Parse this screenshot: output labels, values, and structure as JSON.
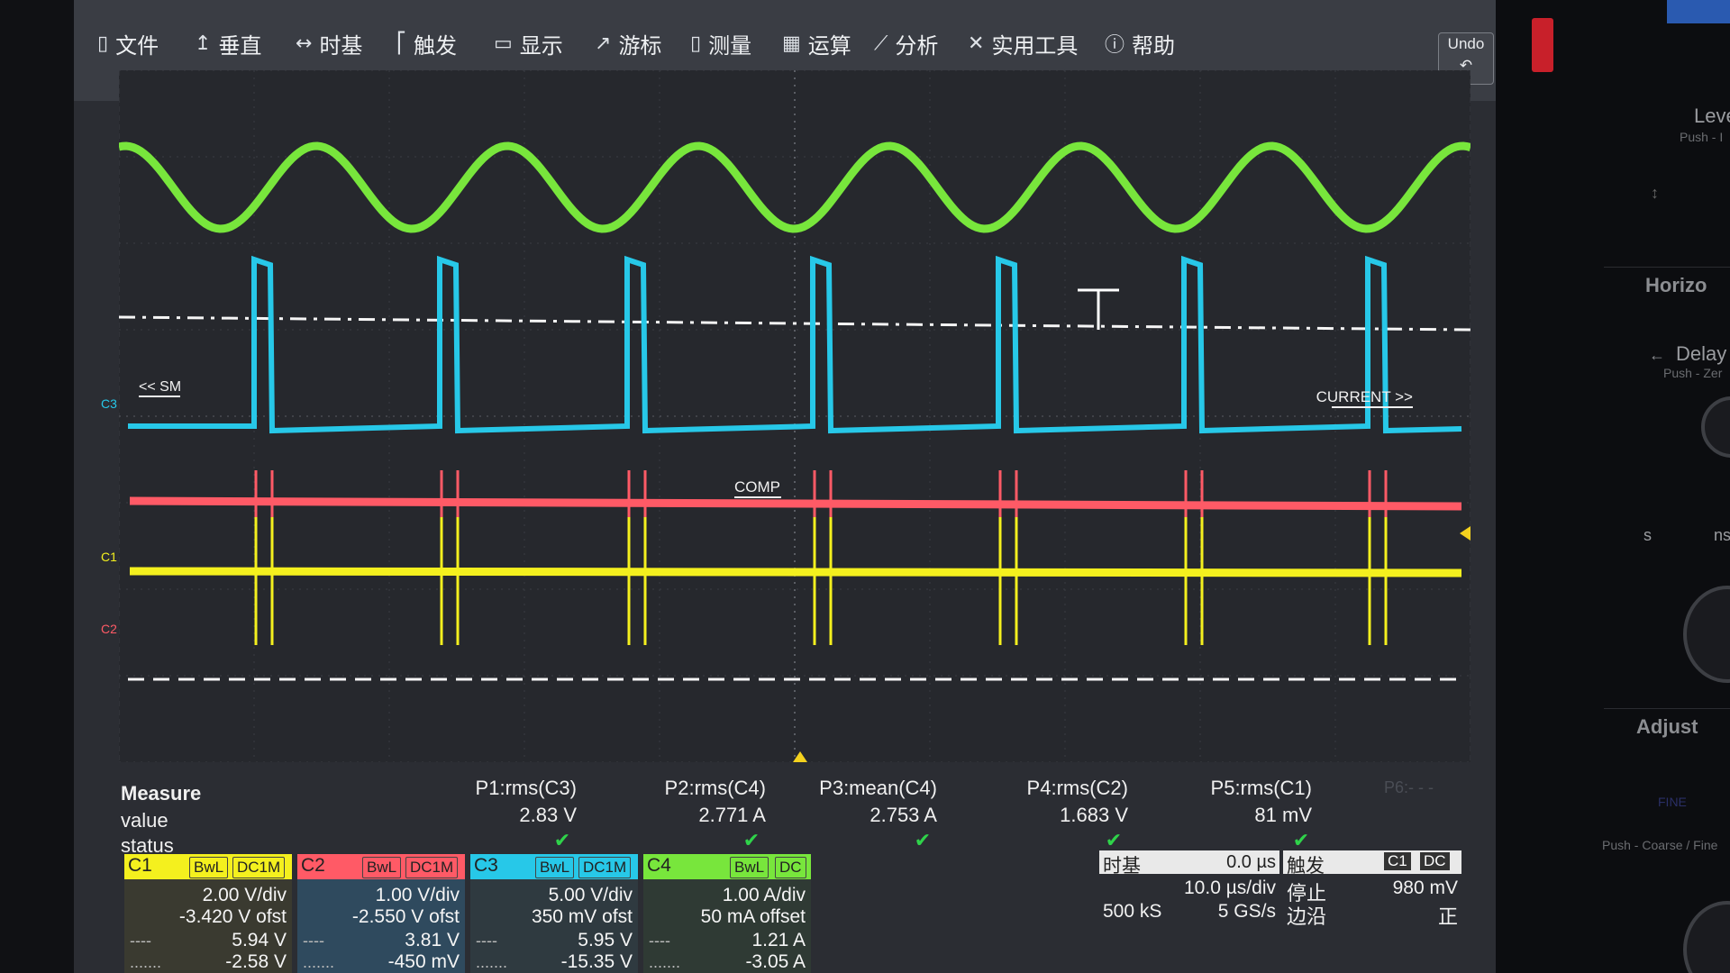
{
  "menu": {
    "items": [
      {
        "icon": "file-icon",
        "glyph": "▯",
        "label": "文件"
      },
      {
        "icon": "vertical-icon",
        "glyph": "↥",
        "label": "垂直"
      },
      {
        "icon": "timebase-icon",
        "glyph": "↔",
        "label": "时基"
      },
      {
        "icon": "trigger-icon",
        "glyph": "⎡",
        "label": "触发"
      },
      {
        "icon": "display-icon",
        "glyph": "▭",
        "label": "显示"
      },
      {
        "icon": "cursor-icon",
        "glyph": "↗",
        "label": "游标"
      },
      {
        "icon": "measure-icon",
        "glyph": "▯",
        "label": "测量"
      },
      {
        "icon": "math-icon",
        "glyph": "▦",
        "label": "运算"
      },
      {
        "icon": "analysis-icon",
        "glyph": "⟋",
        "label": "分析"
      },
      {
        "icon": "utilities-icon",
        "glyph": "✕",
        "label": "实用工具"
      },
      {
        "icon": "help-icon",
        "glyph": "ⓘ",
        "label": "帮助"
      }
    ],
    "undo": "Undo"
  },
  "waveform": {
    "labels": {
      "sm": "<< SM",
      "current": "CURRENT >>",
      "comp": "COMP"
    },
    "channel_markers": {
      "c3": "C3",
      "c1": "C1",
      "c2": "C2"
    },
    "colors": {
      "c1": "#f4f01e",
      "c2": "#ff5a66",
      "c3": "#27c8e8",
      "c4": "#78e63c"
    }
  },
  "measure": {
    "title": "Measure",
    "row_value": "value",
    "row_status": "status",
    "params": [
      {
        "name": "P1:rms(C3)",
        "value": "2.83 V",
        "status": "✔"
      },
      {
        "name": "P2:rms(C4)",
        "value": "2.771 A",
        "status": "✔"
      },
      {
        "name": "P3:mean(C4)",
        "value": "2.753 A",
        "status": "✔"
      },
      {
        "name": "P4:rms(C2)",
        "value": "1.683 V",
        "status": "✔"
      },
      {
        "name": "P5:rms(C1)",
        "value": "81 mV",
        "status": "✔"
      }
    ],
    "p6": "P6:- - -"
  },
  "channels": [
    {
      "name": "C1",
      "bw": "BwL",
      "coupling": "DC1M",
      "vdiv": "2.00 V/div",
      "offset": "-3.420 V ofst",
      "max": "5.94 V",
      "min": "-2.58 V",
      "color": "#f4f01e",
      "bg": "#3a3a30"
    },
    {
      "name": "C2",
      "bw": "BwL",
      "coupling": "DC1M",
      "vdiv": "1.00 V/div",
      "offset": "-2.550 V ofst",
      "max": "3.81 V",
      "min": "-450 mV",
      "color": "#ff5a66",
      "bg": "#2f4a5e"
    },
    {
      "name": "C3",
      "bw": "BwL",
      "coupling": "DC1M",
      "vdiv": "5.00 V/div",
      "offset": "350 mV ofst",
      "max": "5.95 V",
      "min": "-15.35 V",
      "color": "#27c8e8",
      "bg": "#2f3a40"
    },
    {
      "name": "C4",
      "bw": "BwL",
      "coupling": "DC",
      "vdiv": "1.00 A/div",
      "offset": "50 mA offset",
      "max": "1.21 A",
      "min": "-3.05 A",
      "color": "#78e63c",
      "bg": "#2f3a34"
    }
  ],
  "timebase": {
    "label": "时基",
    "delay": "0.0 µs",
    "tdiv": "10.0 µs/div",
    "samples": "500 kS",
    "rate": "5 GS/s"
  },
  "trigger": {
    "label": "触发",
    "source": "C1",
    "coupling": "DC",
    "state": "停止",
    "level": "980 mV",
    "type": "边沿",
    "slope": "正"
  },
  "right_panel": {
    "level": "Leve",
    "level_push": "Push - I",
    "horizontal": "Horizo",
    "delay": "Delay",
    "delay_push": "Push - Zer",
    "s": "s",
    "ns": "ns",
    "adjust": "Adjust",
    "fine": "FINE",
    "adjust_push": "Push - Coarse / Fine"
  }
}
